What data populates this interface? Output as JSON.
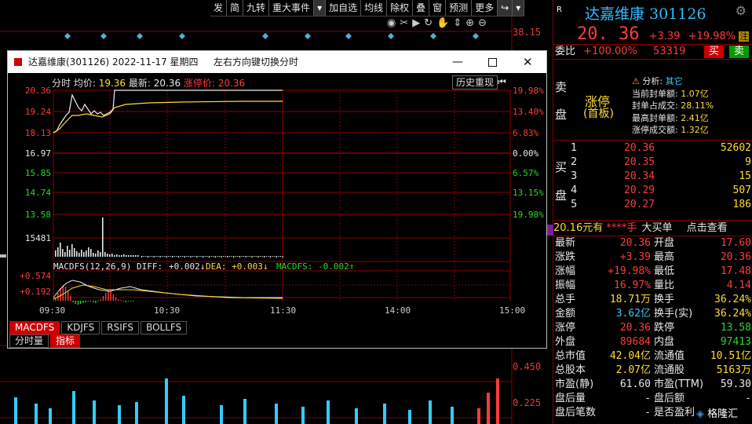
{
  "toolbar": [
    "发",
    "简",
    "九转",
    "重大事件",
    "▾",
    "加自选",
    "均线",
    "除权",
    "叠",
    "窗",
    "预测",
    "更多",
    "↪",
    "▾"
  ],
  "main_axis": {
    "top": "38.15",
    "v1": "0.450",
    "v2": "0.225"
  },
  "right_panel": {
    "badge": "R",
    "title": "达嘉维康 301126",
    "price": "20. 36",
    "change": "+3.39",
    "pct": "+19.98%",
    "flag": "注",
    "weibi_label": "委比",
    "weibi_val": "+100.00%",
    "weibi_num": "53319",
    "sell_btn": "买",
    "buy_btn": "卖",
    "sell_label": "卖",
    "sell_label2": "盘",
    "limit_text": "涨停",
    "limit_sub": "(首板)",
    "analysis_label": "分析:",
    "analysis_val": "其它",
    "stats": [
      {
        "k": "当前封单额:",
        "v": "1.07亿"
      },
      {
        "k": "封单占成交:",
        "v": "28.11%"
      },
      {
        "k": "最高封单额:",
        "v": "2.41亿"
      },
      {
        "k": "涨停成交额:",
        "v": "1.32亿"
      }
    ],
    "buy_label": [
      "买",
      "盘"
    ],
    "bids": [
      {
        "n": "1",
        "p": "20.36",
        "v": "52602"
      },
      {
        "n": "2",
        "p": "20.35",
        "v": "9"
      },
      {
        "n": "3",
        "p": "20.34",
        "v": "15"
      },
      {
        "n": "4",
        "p": "20.29",
        "v": "507"
      },
      {
        "n": "5",
        "p": "20.27",
        "v": "186"
      }
    ],
    "big_order": {
      "a": "20.16元有",
      "b": "****手",
      "c": "大买单",
      "d": "点击查看"
    },
    "quotes": [
      {
        "k1": "最新",
        "v1": "20.36",
        "k2": "开盘",
        "v2": "17.60",
        "c1": "red",
        "c2": "red"
      },
      {
        "k1": "涨跌",
        "v1": "+3.39",
        "k2": "最高",
        "v2": "20.36",
        "c1": "red",
        "c2": "red"
      },
      {
        "k1": "涨幅",
        "v1": "+19.98%",
        "k2": "最低",
        "v2": "17.48",
        "c1": "red",
        "c2": "red"
      },
      {
        "k1": "振幅",
        "v1": "16.97%",
        "k2": "量比",
        "v2": "4.14",
        "c1": "red",
        "c2": "red"
      },
      {
        "k1": "总手",
        "v1": "18.71万",
        "k2": "换手",
        "v2": "36.24%",
        "c1": "yel",
        "c2": "yel"
      },
      {
        "k1": "金额",
        "v1": "3.62亿",
        "k2": "换手(实)",
        "v2": "36.24%",
        "c1": "cyan",
        "c2": "yel"
      },
      {
        "k1": "涨停",
        "v1": "20.36",
        "k2": "跌停",
        "v2": "13.58",
        "c1": "red",
        "c2": "green"
      },
      {
        "k1": "外盘",
        "v1": "89684",
        "k2": "内盘",
        "v2": "97413",
        "c1": "red",
        "c2": "green"
      },
      {
        "k1": "总市值",
        "v1": "42.04亿",
        "k2": "流通值",
        "v2": "10.51亿",
        "c1": "yel",
        "c2": "yel"
      },
      {
        "k1": "总股本",
        "v1": "2.07亿",
        "k2": "流通股",
        "v2": "5163万",
        "c1": "yel",
        "c2": "yel"
      },
      {
        "k1": "市盈(静)",
        "v1": "61.60",
        "k2": "市盈(TTM)",
        "v2": "59.30",
        "c1": "wht",
        "c2": "wht"
      },
      {
        "k1": "盘后量",
        "v1": "-",
        "k2": "盘后额",
        "v2": "-",
        "c1": "wht",
        "c2": "wht"
      },
      {
        "k1": "盘后笔数",
        "v1": "-",
        "k2": "是否盈利",
        "v2": "",
        "c1": "wht",
        "c2": "wht"
      }
    ],
    "watermark": "格隆汇"
  },
  "popup": {
    "title": "达嘉维康(301126) 2022-11-17 星期四",
    "hint": "左右方向键切换分时",
    "header_label": "分时 均价:",
    "avg_price": "19.36",
    "latest_label": "最新:",
    "latest": "20.36",
    "limit_label": "涨停价:",
    "limit_price": "20.36",
    "history_btn": "历史重现",
    "left_axis": [
      "20.36",
      "19.24",
      "18.13",
      "16.97",
      "15.85",
      "14.74",
      "13.58",
      "15481",
      "+0.574",
      "+0.192"
    ],
    "right_axis": [
      "19.98%",
      "13.40%",
      "6.83%",
      "0.00%",
      "6.57%",
      "13.15%",
      "19.98%"
    ],
    "time_labels": [
      "09:30",
      "10:30",
      "11:30",
      "14:00",
      "15:00"
    ],
    "macd_label": "MACDFS(12,26,9) DIFF:",
    "diff": "+0.002↓",
    "dea": "DEA: +0.003↓",
    "macdfs": "MACDFS: -0.002↑",
    "indicator_tabs": [
      "MACDFS",
      "KDJFS",
      "RSIFS",
      "BOLLFS"
    ],
    "bottom_tabs": [
      "分时量",
      "指标"
    ]
  }
}
